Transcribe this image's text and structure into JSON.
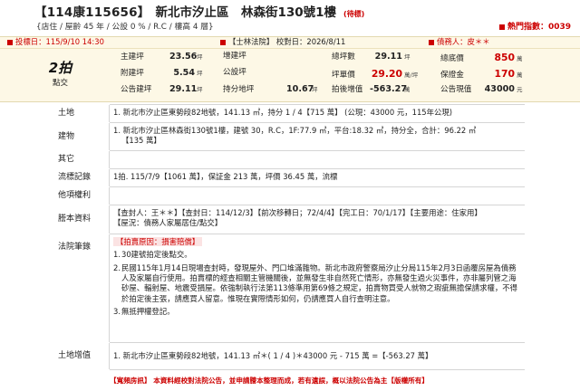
{
  "header": {
    "case_no": "【114康115656】",
    "address": "新北市汐止區　林森街130號1樓",
    "status": "(待標)",
    "subtitle": "{店住 / 屋齡 45 年 / 公設 0 % / R.C / 樓高 4 層}",
    "hot_label": "熱門指數：0039"
  },
  "summary": {
    "auction_date": "投標日：115/9/10 14:30",
    "court": "【士林法院】 校對日：2026/8/11",
    "debtor": "債務人：皮＊＊",
    "round_big": "2拍",
    "round_small": "點交",
    "col1": [
      {
        "label": "主建坪",
        "value": "23.56",
        "unit": "坪"
      },
      {
        "label": "附建坪",
        "value": "5.54",
        "unit": "坪"
      },
      {
        "label": "公告建坪",
        "value": "29.11",
        "unit": "坪"
      }
    ],
    "col2": [
      {
        "label": "增建坪",
        "value": "",
        "unit": ""
      },
      {
        "label": "公設坪",
        "value": "",
        "unit": ""
      },
      {
        "label": "持分地坪",
        "value": "10.67",
        "unit": "坪"
      }
    ],
    "col3": [
      {
        "label": "總坪數",
        "value": "29.11",
        "unit": "坪",
        "red": false
      },
      {
        "label": "坪單價",
        "value": "29.20",
        "unit": "萬/坪",
        "red": true
      },
      {
        "label": "拍後增值",
        "value": "-563.27",
        "unit": "萬",
        "red": false
      }
    ],
    "col4": [
      {
        "label": "總底價",
        "value": "850",
        "unit": "萬",
        "red": true
      },
      {
        "label": "保證金",
        "value": "170",
        "unit": "萬",
        "red": true
      },
      {
        "label": "公告現值",
        "value": "43000",
        "unit": "元",
        "red": false
      }
    ]
  },
  "rows": [
    {
      "head": "土地",
      "lines": [
        "1. 新北市汐止區東勢段82地號，141.13 ㎡，持分 1 / 4【715 萬】 (公現：43000 元，115年公現)"
      ]
    },
    {
      "head": "建物",
      "lines": [
        "1. 新北市汐止區林森街130號1樓，建號 30，R.C，1F:77.9 ㎡，平台:18.32 ㎡，持分全，合計：96.22 ㎡",
        "【135 萬】"
      ]
    },
    {
      "head": "其它",
      "lines": [
        ""
      ]
    },
    {
      "head": "流標記錄",
      "lines": [
        "1拍. 115/7/9【1061 萬】，保証金 213 萬，坪價 36.45 萬，流標"
      ]
    },
    {
      "head": "他項權利",
      "lines": [
        ""
      ]
    },
    {
      "head": "謄本資料",
      "lines": [
        "【查封人：王＊＊】【查封日：114/12/3】【前次移轉日；72/4/4】【完工日：70/1/17】【主要用途：住家用】",
        "【屋況：債務人家屬居住/點交】"
      ]
    }
  ],
  "notes": {
    "head": "法院筆錄",
    "reason": "【拍賣原因：損害賠償】",
    "items": [
      {
        "n": "1.",
        "t": "30建號拍定後點交。"
      },
      {
        "n": "2.",
        "t": "民國115年1月14日現場查封時，發現屋外、門口堆滿雜物。新北市政府警察局汐止分局115年2月3日函覆房屋為債務人及家屬自行使用。拍賣標的經查相關主管機關後，並無發生非自然死亡情形，亦無發生過火災事件，亦非屬列管之海砂屋、輻射屋、地震受損屋。依強制執行法第113條準用第69條之規定，拍賣物買受人就物之瑕疵無擔保請求權，不得於拍定後主張，請應買人留意。惟現在實際情形如何，仍請應買人自行查明注意。"
      },
      {
        "n": "3.",
        "t": "無抵押權登記。"
      }
    ]
  },
  "land_increment": {
    "head": "土地增值",
    "text": "1. 新北市汐止區東勢段82地號，141.13 ㎡＊( 1 / 4 )＊43000 元 - 715 萬 =【-563.27 萬】"
  },
  "footer": "【寬頻房訊】 本資料經校對法院公告，並申請謄本整理而成，若有遺誤，概以法院公告為主【版權所有】"
}
